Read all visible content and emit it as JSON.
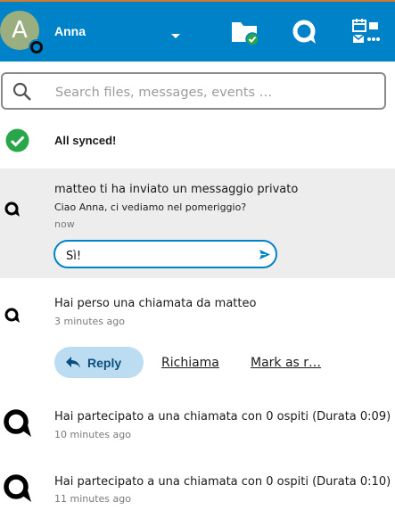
{
  "header": {
    "avatar_initial": "A",
    "user_name": "Anna",
    "accent_color": "#0082c9"
  },
  "icons": {
    "caret": "caret-down-icon",
    "folder": "folder-synced-icon",
    "talk": "talk-icon",
    "apps": "calendar-mail-apps-icon",
    "search": "search-icon",
    "sync": "check-circle-icon",
    "send": "send-icon",
    "reply": "reply-arrow-icon"
  },
  "search": {
    "placeholder": "Search files, messages, events …",
    "value": ""
  },
  "sync": {
    "status_text": "All synced!",
    "status_color": "#2aa64a"
  },
  "activities": [
    {
      "title": "matteo ti ha inviato un messaggio privato",
      "message": "Ciao Anna, ci vediamo nel pomeriggio?",
      "time": "now",
      "reply_value": "Sì!"
    },
    {
      "title": "Hai perso una chiamata da matteo",
      "time": "3 minutes ago",
      "actions": {
        "reply": "Reply",
        "call_back": "Richiama",
        "mark_as_read": "Mark as r…"
      }
    },
    {
      "title": "Hai partecipato a una chiamata con 0 ospiti (Durata 0:09)",
      "time": "10 minutes ago"
    },
    {
      "title": "Hai partecipato a una chiamata con 0 ospiti (Durata 0:10)",
      "time": "11 minutes ago"
    }
  ]
}
